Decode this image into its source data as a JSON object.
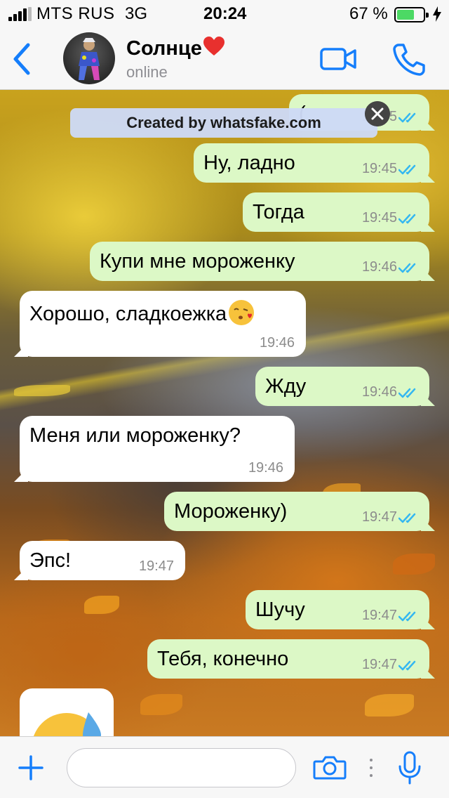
{
  "status_bar": {
    "carrier": "MTS RUS",
    "network": "3G",
    "time": "20:24",
    "battery_percent": "67 %",
    "battery_level": 0.67,
    "icons": [
      "signal-icon",
      "battery-icon",
      "charging-bolt-icon"
    ]
  },
  "header": {
    "contact_name": "Солнце",
    "contact_emoji": "heart-emoji",
    "status": "online",
    "icons": [
      "back-chevron-icon",
      "video-call-icon",
      "phone-call-icon"
    ]
  },
  "watermark": {
    "text": "Created by whatsfake.com"
  },
  "messages": [
    {
      "direction": "out",
      "text": "(",
      "time": "19:45",
      "status": "read",
      "partially_hidden": true
    },
    {
      "direction": "out",
      "text": "Ну, ладно",
      "time": "19:45",
      "status": "read"
    },
    {
      "direction": "out",
      "text": "Тогда",
      "time": "19:45",
      "status": "read"
    },
    {
      "direction": "out",
      "text": "Купи мне мороженку",
      "time": "19:46",
      "status": "read"
    },
    {
      "direction": "in",
      "text": "Хорошо, сладкоежка",
      "emoji": "kissing-heart-emoji",
      "time": "19:46"
    },
    {
      "direction": "out",
      "text": "Жду",
      "time": "19:46",
      "status": "read"
    },
    {
      "direction": "in",
      "text": "Меня или мороженку?",
      "time": "19:46"
    },
    {
      "direction": "out",
      "text": "Мороженку)",
      "time": "19:47",
      "status": "read"
    },
    {
      "direction": "in",
      "text": "Эпс!",
      "time": "19:47"
    },
    {
      "direction": "out",
      "text": "Шучу",
      "time": "19:47",
      "status": "read"
    },
    {
      "direction": "out",
      "text": "Тебя, конечно",
      "time": "19:47",
      "status": "read"
    },
    {
      "direction": "in",
      "emoji": "sweat-smile-emoji",
      "partially_hidden": true
    }
  ],
  "input_bar": {
    "placeholder": "",
    "icons": [
      "plus-icon",
      "camera-icon",
      "more-dots-icon",
      "microphone-icon"
    ]
  },
  "colors": {
    "accent": "#157efb",
    "outgoing_bubble": "#dcf8c6",
    "incoming_bubble": "#ffffff",
    "read_ticks": "#34b7f1",
    "battery_fill": "#4cd964"
  }
}
